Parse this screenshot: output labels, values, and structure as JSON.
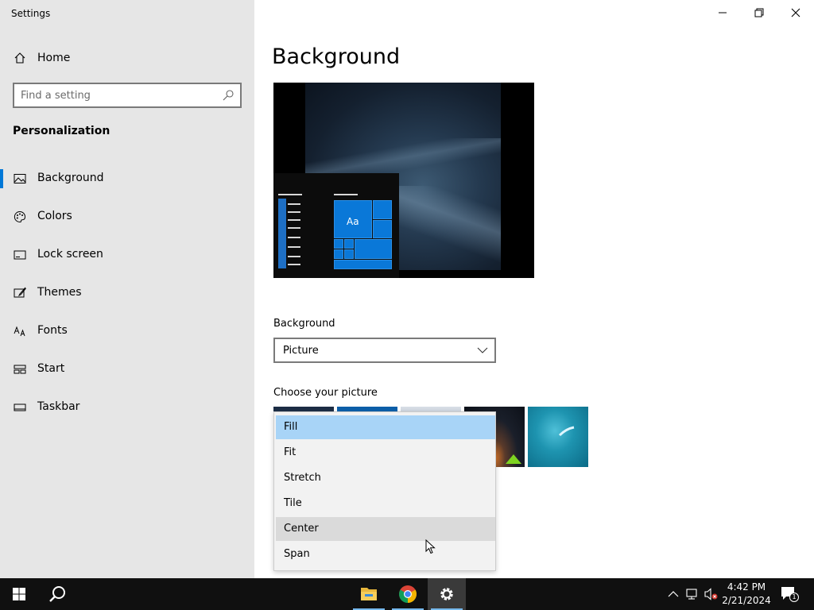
{
  "window": {
    "title": "Settings"
  },
  "sidebar": {
    "home_label": "Home",
    "search_placeholder": "Find a setting",
    "section_title": "Personalization",
    "items": [
      {
        "label": "Background",
        "icon": "picture-icon",
        "active": true
      },
      {
        "label": "Colors",
        "icon": "palette-icon",
        "active": false
      },
      {
        "label": "Lock screen",
        "icon": "lock-screen-icon",
        "active": false
      },
      {
        "label": "Themes",
        "icon": "themes-icon",
        "active": false
      },
      {
        "label": "Fonts",
        "icon": "fonts-icon",
        "active": false
      },
      {
        "label": "Start",
        "icon": "start-icon",
        "active": false
      },
      {
        "label": "Taskbar",
        "icon": "taskbar-icon",
        "active": false
      }
    ]
  },
  "main": {
    "page_title": "Background",
    "preview_tile_text": "Aa",
    "background_label": "Background",
    "background_value": "Picture",
    "choose_label": "Choose your picture"
  },
  "fit_dropdown": {
    "options": [
      "Fill",
      "Fit",
      "Stretch",
      "Tile",
      "Center",
      "Span"
    ],
    "selected": "Fill",
    "hovered": "Center"
  },
  "taskbar": {
    "apps": [
      "file-explorer-icon",
      "chrome-icon",
      "settings-gear-icon"
    ],
    "time": "4:42 PM",
    "date": "2/21/2024",
    "notification_count": "1"
  },
  "colors": {
    "accent": "#0078d7",
    "sidebar_bg": "#e6e6e6",
    "selected_option": "#a8d4f7",
    "taskbar_bg": "#101010"
  }
}
